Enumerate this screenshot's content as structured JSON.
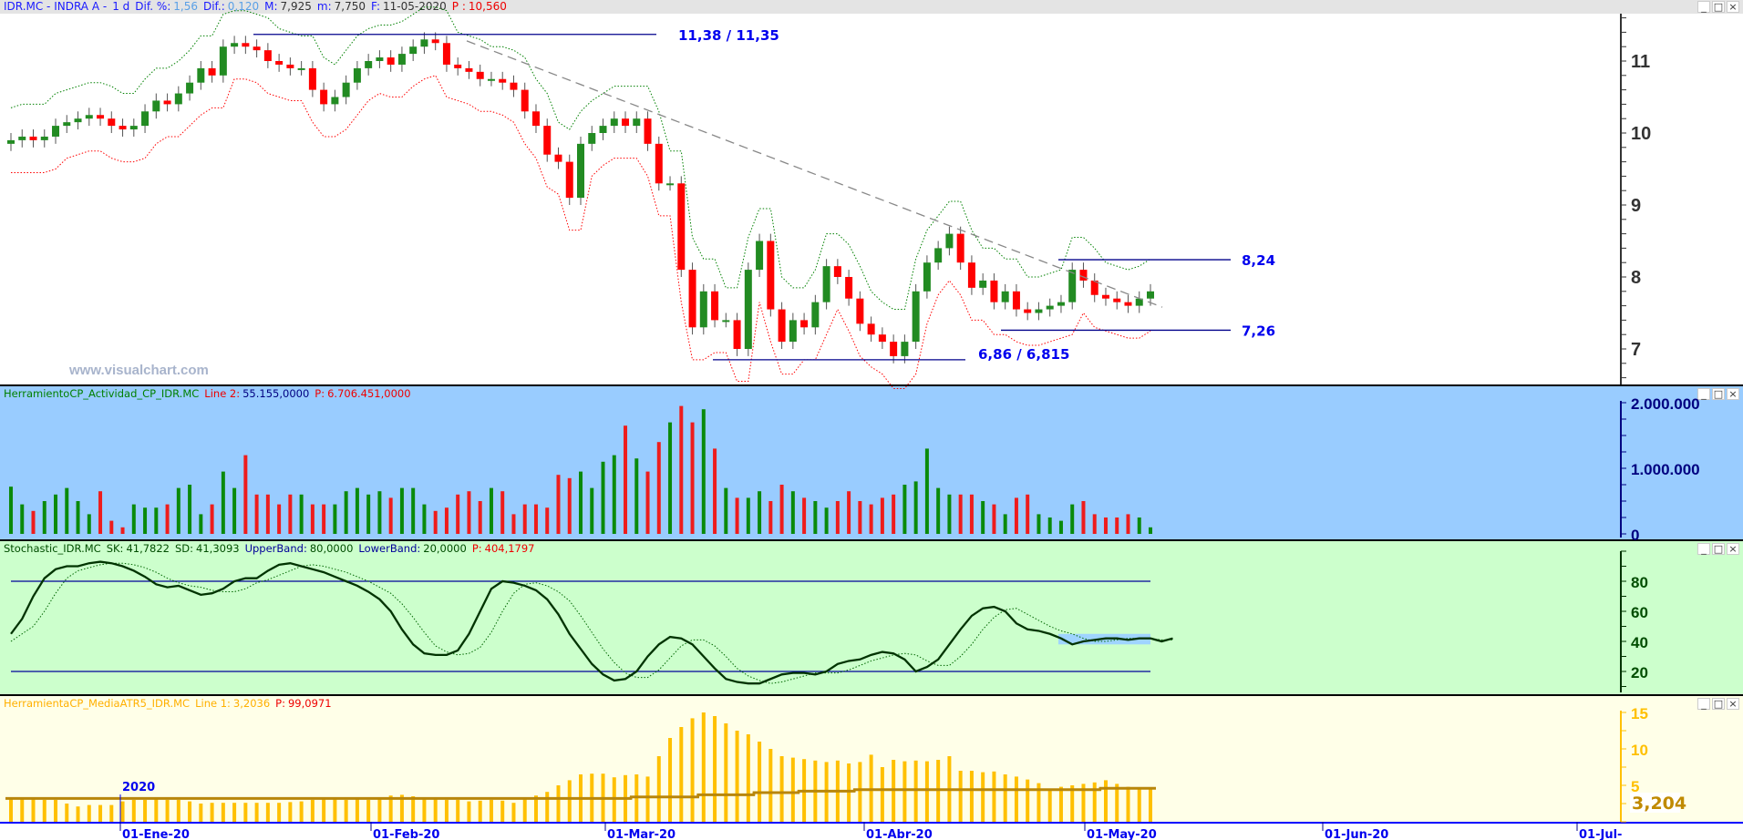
{
  "title_bar": {
    "symbol": "IDR.MC - INDRA A -",
    "period": "1 d",
    "dif_pct_label": "Dif. %:",
    "dif_pct": "1,56",
    "dif_label": "Dif.:",
    "dif": "0,120",
    "max_label": "M:",
    "max": "7,925",
    "min_label": "m:",
    "min": "7,750",
    "date_label": "F:",
    "date": "11-05-2020",
    "p_label": "P :",
    "p": "10,560"
  },
  "window_buttons": {
    "minimize": "_",
    "maximize": "□",
    "close": "×"
  },
  "watermark": "www.visualchart.com",
  "price_panel": {
    "y_ticks": [
      "11",
      "10",
      "9",
      "8",
      "7"
    ],
    "levels": [
      {
        "label": "11,38 / 11,35",
        "value": 11.37
      },
      {
        "label": "8,24",
        "value": 8.24
      },
      {
        "label": "7,26",
        "value": 7.26
      },
      {
        "label": "6,86 / 6,815",
        "value": 6.85
      }
    ],
    "closes": [
      9.9,
      9.95,
      9.9,
      9.95,
      10.1,
      10.15,
      10.2,
      10.25,
      10.2,
      10.1,
      10.05,
      10.1,
      10.3,
      10.45,
      10.4,
      10.55,
      10.7,
      10.9,
      10.8,
      11.2,
      11.25,
      11.2,
      11.15,
      11.0,
      10.95,
      10.9,
      10.9,
      10.6,
      10.4,
      10.5,
      10.7,
      10.9,
      11.0,
      11.05,
      10.95,
      11.1,
      11.2,
      11.3,
      11.25,
      10.95,
      10.9,
      10.85,
      10.75,
      10.75,
      10.7,
      10.6,
      10.3,
      10.1,
      9.7,
      9.6,
      9.1,
      9.85,
      10.0,
      10.1,
      10.2,
      10.1,
      10.2,
      9.85,
      9.3,
      9.3,
      8.1,
      7.3,
      7.8,
      7.4,
      7.4,
      7.0,
      8.1,
      8.5,
      7.55,
      7.1,
      7.4,
      7.3,
      7.65,
      8.15,
      8.0,
      7.7,
      7.35,
      7.2,
      7.1,
      6.9,
      7.1,
      7.8,
      8.2,
      8.4,
      8.6,
      8.2,
      7.85,
      7.95,
      7.65,
      7.8,
      7.55,
      7.5,
      7.55,
      7.6,
      7.65,
      8.1,
      7.95,
      7.75,
      7.7,
      7.65,
      7.6,
      7.7,
      7.8
    ],
    "colors": {
      "up": "#228b22",
      "down": "#ff0000",
      "upper_band": "#008000",
      "lower_band": "#ff0000",
      "trendline": "#888888",
      "level": "#0000cc"
    }
  },
  "volume_panel": {
    "header": {
      "name": "HerramientoCP_Actividad_CP_IDR.MC",
      "line_label": "Line 2:",
      "line_value": "55.155,0000",
      "p_label": "P:",
      "p_value": "6.706.451,0000"
    },
    "y_ticks": [
      "2.000.000",
      "1.000.000",
      "0"
    ],
    "values_millions": [
      0.72,
      0.45,
      0.35,
      0.5,
      0.6,
      0.7,
      0.5,
      0.3,
      0.65,
      0.2,
      0.1,
      0.45,
      0.4,
      0.4,
      0.45,
      0.7,
      0.75,
      0.3,
      0.45,
      0.95,
      0.7,
      1.2,
      0.6,
      0.6,
      0.45,
      0.6,
      0.6,
      0.45,
      0.45,
      0.45,
      0.65,
      0.7,
      0.6,
      0.65,
      0.55,
      0.7,
      0.7,
      0.45,
      0.35,
      0.4,
      0.6,
      0.65,
      0.5,
      0.7,
      0.65,
      0.3,
      0.45,
      0.45,
      0.4,
      0.9,
      0.85,
      0.95,
      0.7,
      1.1,
      1.2,
      1.65,
      1.15,
      0.95,
      1.4,
      1.7,
      1.95,
      1.7,
      1.9,
      1.3,
      0.7,
      0.55,
      0.55,
      0.65,
      0.5,
      0.75,
      0.65,
      0.55,
      0.5,
      0.4,
      0.5,
      0.65,
      0.5,
      0.45,
      0.55,
      0.6,
      0.75,
      0.8,
      1.3,
      0.7,
      0.6,
      0.6,
      0.6,
      0.5,
      0.45,
      0.3,
      0.55,
      0.6,
      0.3,
      0.25,
      0.2,
      0.45,
      0.5,
      0.3,
      0.25,
      0.25,
      0.3,
      0.25,
      0.1
    ]
  },
  "stochastic_panel": {
    "header": {
      "name": "Stochastic_IDR.MC",
      "sk_label": "SK:",
      "sk": "41,7822",
      "sd_label": "SD:",
      "sd": "41,3093",
      "upper_label": "UpperBand:",
      "upper": "80,0000",
      "lower_label": "LowerBand:",
      "lower": "20,0000",
      "p_label": "P:",
      "p": "404,1797"
    },
    "y_ticks": [
      "80",
      "60",
      "40",
      "20"
    ],
    "upper_band": 80,
    "lower_band": 20,
    "sk": [
      45,
      55,
      70,
      82,
      88,
      90,
      90,
      92,
      93,
      92,
      90,
      87,
      83,
      78,
      76,
      77,
      74,
      71,
      72,
      75,
      80,
      82,
      82,
      87,
      91,
      92,
      90,
      88,
      86,
      83,
      80,
      77,
      73,
      68,
      60,
      48,
      38,
      32,
      31,
      31,
      34,
      45,
      60,
      75,
      80,
      79,
      77,
      74,
      68,
      58,
      45,
      35,
      25,
      18,
      14,
      15,
      20,
      30,
      38,
      43,
      42,
      38,
      30,
      22,
      15,
      13,
      12,
      12,
      15,
      18,
      19,
      19,
      18,
      20,
      25,
      27,
      28,
      31,
      33,
      32,
      28,
      20,
      23,
      28,
      38,
      48,
      57,
      62,
      63,
      60,
      52,
      48,
      47,
      45,
      42,
      38,
      40,
      41,
      42,
      42,
      41,
      42,
      42,
      40,
      42
    ],
    "sd": [
      40,
      45,
      50,
      60,
      72,
      82,
      87,
      89,
      91,
      92,
      92,
      91,
      89,
      86,
      82,
      79,
      77,
      76,
      74,
      73,
      73,
      75,
      79,
      81,
      84,
      87,
      90,
      91,
      90,
      88,
      86,
      83,
      80,
      76,
      72,
      65,
      56,
      46,
      37,
      33,
      31,
      32,
      36,
      46,
      60,
      72,
      78,
      79,
      77,
      73,
      67,
      57,
      46,
      35,
      26,
      19,
      16,
      16,
      21,
      29,
      37,
      41,
      41,
      37,
      30,
      22,
      17,
      14,
      12,
      13,
      15,
      17,
      19,
      19,
      19,
      21,
      24,
      27,
      29,
      31,
      32,
      31,
      27,
      24,
      24,
      30,
      38,
      48,
      56,
      61,
      62,
      58,
      54,
      50,
      47,
      45,
      42,
      40,
      40,
      41,
      42,
      42,
      42,
      41,
      41
    ],
    "colors": {
      "sk": "#003300",
      "sd": "#006600",
      "bands": "#000099"
    }
  },
  "atr_panel": {
    "header": {
      "name": "HerramientaCP_MediaATR5_IDR.MC",
      "line_label": "Line 1:",
      "line_value": "3,2036",
      "p_label": "P:",
      "p_value": "99,0971"
    },
    "y_ticks": [
      "15",
      "10",
      "5"
    ],
    "current_label": "3,204",
    "values": [
      3.2,
      3.3,
      3.3,
      3.0,
      3.0,
      2.5,
      2.1,
      2.3,
      2.3,
      2.3,
      2.8,
      3.0,
      3.0,
      3.1,
      3.0,
      3.0,
      2.8,
      2.5,
      2.6,
      2.6,
      2.6,
      2.6,
      2.6,
      2.6,
      2.6,
      2.7,
      2.8,
      3.0,
      3.1,
      3.2,
      3.0,
      3.1,
      3.0,
      3.3,
      3.6,
      3.7,
      3.5,
      3.2,
      3.1,
      3.0,
      3.0,
      2.8,
      2.9,
      3.0,
      2.9,
      2.6,
      3.1,
      3.6,
      4.1,
      5.0,
      5.7,
      6.5,
      6.6,
      6.6,
      6.1,
      6.4,
      6.5,
      6.2,
      9.0,
      11.5,
      13.0,
      14.2,
      15.0,
      14.5,
      13.5,
      12.5,
      12.0,
      11.0,
      10.0,
      9.0,
      8.8,
      8.6,
      8.4,
      8.2,
      8.4,
      8.0,
      8.2,
      9.2,
      7.5,
      8.5,
      8.3,
      8.4,
      8.3,
      8.5,
      9.0,
      7.0,
      7.0,
      6.8,
      6.9,
      6.5,
      6.2,
      5.8,
      5.3,
      4.3,
      4.8,
      5.0,
      5.2,
      5.4,
      5.7,
      5.2,
      4.8,
      4.6,
      4.5
    ],
    "average": [
      3.2,
      3.2,
      3.2,
      3.2,
      3.2,
      3.2,
      3.2,
      3.2,
      3.2,
      3.2,
      3.2,
      3.2,
      3.2,
      3.2,
      3.2,
      3.2,
      3.2,
      3.2,
      3.2,
      3.2,
      3.2,
      3.2,
      3.2,
      3.2,
      3.2,
      3.2,
      3.2,
      3.2,
      3.2,
      3.2,
      3.2,
      3.2,
      3.2,
      3.2,
      3.2,
      3.2,
      3.2,
      3.2,
      3.2,
      3.2,
      3.2,
      3.2,
      3.2,
      3.2,
      3.2,
      3.2,
      3.2,
      3.2,
      3.2,
      3.2,
      3.2,
      3.2,
      3.2,
      3.2,
      3.2,
      3.2,
      3.4,
      3.4,
      3.4,
      3.4,
      3.4,
      3.4,
      3.7,
      3.7,
      3.7,
      3.7,
      3.7,
      4.0,
      4.0,
      4.0,
      4.0,
      4.2,
      4.2,
      4.2,
      4.2,
      4.2,
      4.4,
      4.4,
      4.4,
      4.4,
      4.4,
      4.4,
      4.4,
      4.4,
      4.4,
      4.4,
      4.4,
      4.4,
      4.4,
      4.4,
      4.4,
      4.4,
      4.4,
      4.4,
      4.4,
      4.4,
      4.4,
      4.4,
      4.6,
      4.6,
      4.6,
      4.6,
      4.6
    ],
    "colors": {
      "bars": "#ffc000",
      "average": "#b8860b"
    }
  },
  "date_axis": {
    "year_label": "2020",
    "ticks": [
      "01-Ene-20",
      "01-Feb-20",
      "01-Mar-20",
      "01-Abr-20",
      "01-May-20",
      "01-Jun-20",
      "01-Jul-"
    ]
  }
}
